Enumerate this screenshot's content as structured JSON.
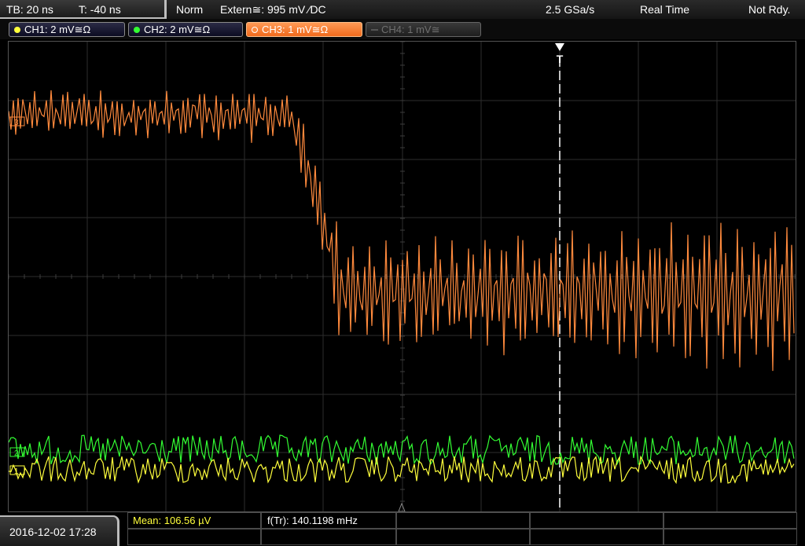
{
  "header": {
    "timebase": "TB: 20 ns",
    "trigger_offset": "T: -40 ns",
    "trigger_mode": "Norm",
    "trigger_source": "Extern≅: 995 mV ⁄DC",
    "sample_rate": "2.5 GSa/s",
    "acquisition_mode": "Real Time",
    "status": "Not Rdy."
  },
  "channels": [
    {
      "label": "CH1: 2 mV≅Ω",
      "color": "#ffff3c",
      "state": "on"
    },
    {
      "label": "CH2: 2 mV≅Ω",
      "color": "#33ff33",
      "state": "on"
    },
    {
      "label": "CH3: 1 mV≅Ω",
      "color": "#ff8a3d",
      "state": "active"
    },
    {
      "label": "CH4: 1 mV≅",
      "color": "#6f6f6f",
      "state": "off"
    }
  ],
  "footer": {
    "datetime": "2016-12-02 17:28",
    "measurement_1": "Mean: 106.56 µV",
    "measurement_2": "f(Tr): 140.1198 mHz"
  },
  "markers": {
    "trigger_position": "T",
    "ch_markers": [
      "1",
      "2",
      "3"
    ]
  },
  "colors": {
    "ch1": "#ffff3c",
    "ch2": "#33ff33",
    "ch3": "#ff8a3d",
    "grid": "#3a3a3a"
  }
}
